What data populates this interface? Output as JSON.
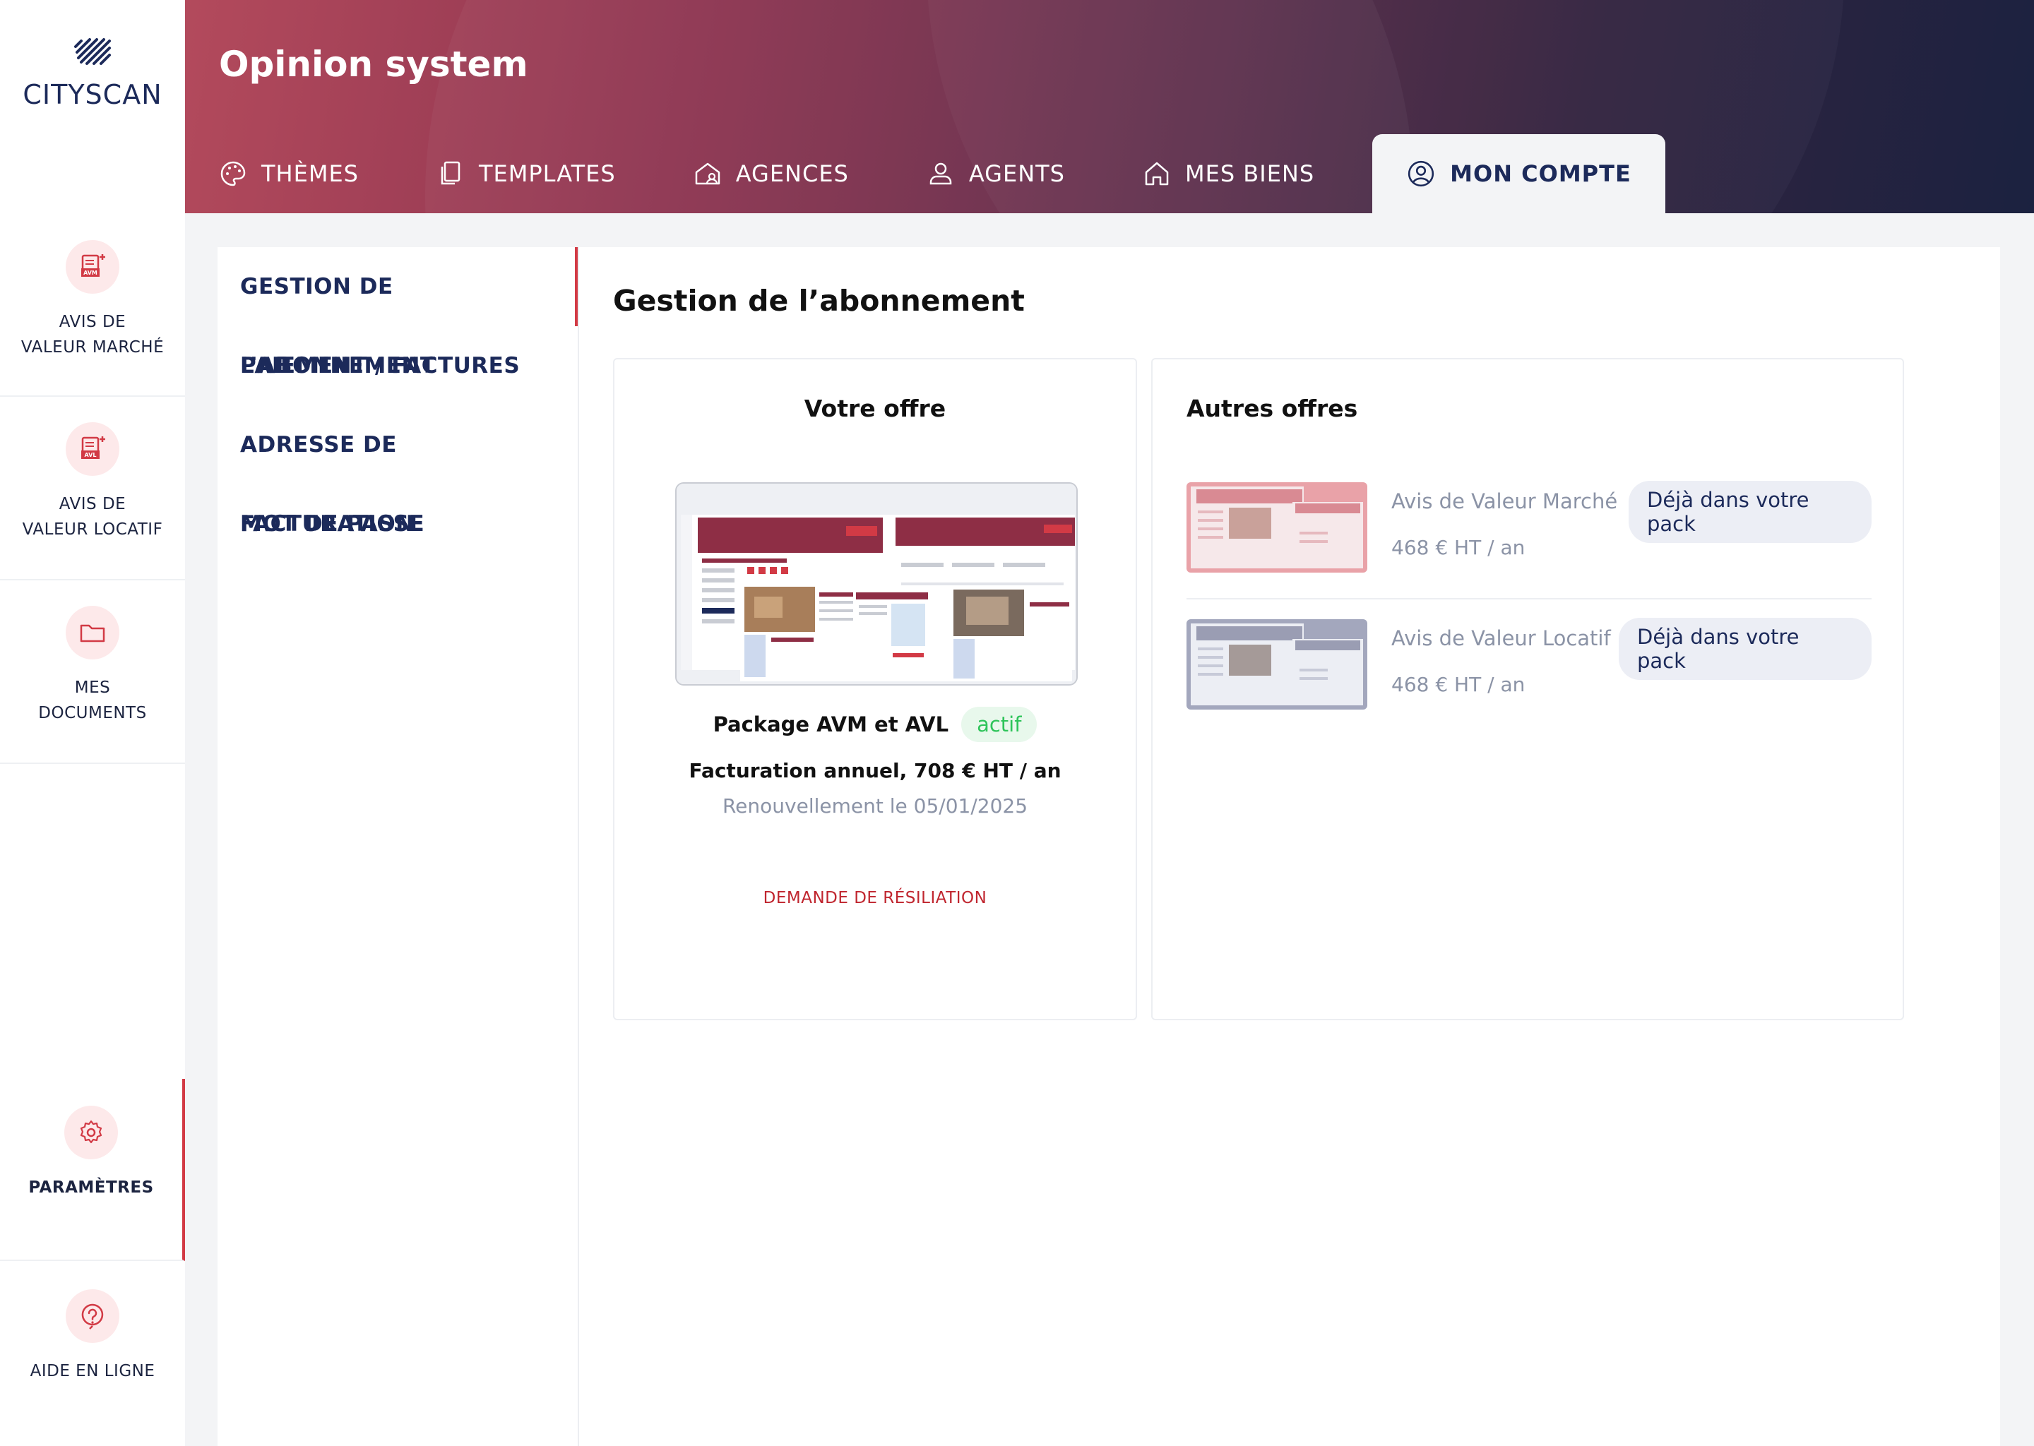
{
  "brand": {
    "logo_text": "CITYSCAN",
    "accent": "#d23a45"
  },
  "rail": {
    "items": [
      {
        "label": "AVIS DE\nVALEUR MARCHÉ",
        "icon": "avm-report-icon",
        "badge": "AVM"
      },
      {
        "label": "AVIS DE\nVALEUR LOCATIF",
        "icon": "avl-report-icon",
        "badge": "AVL"
      },
      {
        "label": "MES\nDOCUMENTS",
        "icon": "folder-icon"
      },
      {
        "label": "PARAMÈTRES",
        "icon": "gear-icon",
        "active": true
      },
      {
        "label": "AIDE EN LIGNE",
        "icon": "help-icon"
      }
    ]
  },
  "header": {
    "title": "Opinion system",
    "tabs": [
      {
        "label": "THÈMES",
        "icon": "palette-icon"
      },
      {
        "label": "TEMPLATES",
        "icon": "copy-icon"
      },
      {
        "label": "AGENCES",
        "icon": "agency-icon"
      },
      {
        "label": "AGENTS",
        "icon": "user-icon"
      },
      {
        "label": "MES BIENS",
        "icon": "home-icon"
      },
      {
        "label": "MON COMPTE",
        "icon": "account-circle-icon",
        "active": true
      }
    ]
  },
  "subnav": {
    "items": [
      {
        "label": "GESTION DE L’ABONNEMENT",
        "active": true
      },
      {
        "label": "PAIEMENT / FACTURES"
      },
      {
        "label": "ADRESSE DE FACTURATION"
      },
      {
        "label": "MOT DE PASSE"
      }
    ]
  },
  "main": {
    "title": "Gestion de l’abonnement",
    "offer": {
      "title": "Votre offre",
      "package_name": "Package AVM et AVL",
      "status": "actif",
      "billing": "Facturation annuel, 708 € HT / an",
      "renewal": "Renouvellement le 05/01/2025",
      "cancel_label": "DEMANDE DE RÉSILIATION"
    },
    "others": {
      "title": "Autres offres",
      "items": [
        {
          "name": "Avis de Valeur Marché",
          "pill": "Déjà dans votre pack",
          "price": "468 € HT / an",
          "tint": "#e9a2a8"
        },
        {
          "name": "Avis de Valeur Locatif",
          "pill": "Déjà dans votre pack",
          "price": "468 € HT / an",
          "tint": "#a3a7bd"
        }
      ]
    }
  }
}
